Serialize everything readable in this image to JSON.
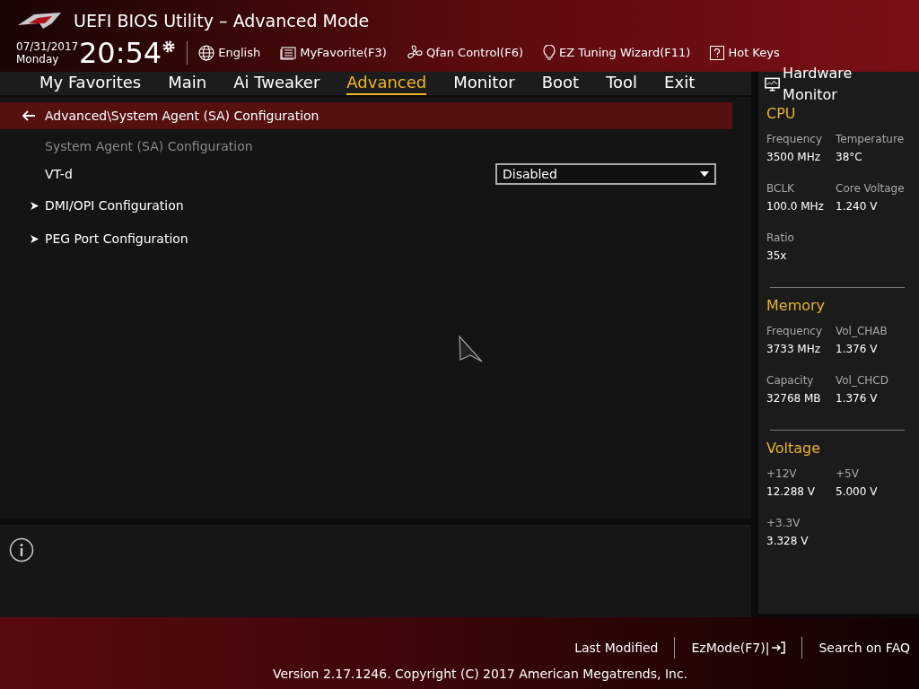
{
  "header": {
    "title": "UEFI BIOS Utility – Advanced Mode",
    "date": "07/31/2017",
    "day": "Monday",
    "time": "20:54",
    "tools": [
      {
        "label": "English"
      },
      {
        "label": "MyFavorite(F3)"
      },
      {
        "label": "Qfan Control(F6)"
      },
      {
        "label": "EZ Tuning Wizard(F11)"
      },
      {
        "label": "Hot Keys"
      }
    ]
  },
  "tabs": [
    {
      "label": "My Favorites",
      "selected": false
    },
    {
      "label": "Main",
      "selected": false
    },
    {
      "label": "Ai Tweaker",
      "selected": false
    },
    {
      "label": "Advanced",
      "selected": true
    },
    {
      "label": "Monitor",
      "selected": false
    },
    {
      "label": "Boot",
      "selected": false
    },
    {
      "label": "Tool",
      "selected": false
    },
    {
      "label": "Exit",
      "selected": false
    }
  ],
  "breadcrumb": "Advanced\\System Agent (SA) Configuration",
  "section_title": "System Agent (SA) Configuration",
  "settings": [
    {
      "kind": "dropdown",
      "label": "VT-d",
      "value": "Disabled"
    },
    {
      "kind": "submenu",
      "label": "DMI/OPI Configuration"
    },
    {
      "kind": "submenu",
      "label": "PEG Port Configuration"
    }
  ],
  "hardware_monitor": {
    "title": "Hardware Monitor",
    "groups": [
      {
        "title": "CPU",
        "items": [
          {
            "label": "Frequency",
            "value": "3500 MHz"
          },
          {
            "label": "Temperature",
            "value": "38°C"
          },
          {
            "label": "BCLK",
            "value": "100.0 MHz"
          },
          {
            "label": "Core Voltage",
            "value": "1.240 V"
          },
          {
            "label": "Ratio",
            "value": "35x"
          }
        ]
      },
      {
        "title": "Memory",
        "items": [
          {
            "label": "Frequency",
            "value": "3733 MHz"
          },
          {
            "label": "Vol_CHAB",
            "value": "1.376 V"
          },
          {
            "label": "Capacity",
            "value": "32768 MB"
          },
          {
            "label": "Vol_CHCD",
            "value": "1.376 V"
          }
        ]
      },
      {
        "title": "Voltage",
        "items": [
          {
            "label": "+12V",
            "value": "12.288 V"
          },
          {
            "label": "+5V",
            "value": "5.000 V"
          },
          {
            "label": "+3.3V",
            "value": "3.328 V"
          }
        ]
      }
    ]
  },
  "footer": {
    "buttons": [
      {
        "label": "Last Modified"
      },
      {
        "label": "EzMode(F7)|"
      },
      {
        "label": "Search on FAQ"
      }
    ],
    "version": "Version 2.17.1246. Copyright (C) 2017 American Megatrends, Inc."
  }
}
